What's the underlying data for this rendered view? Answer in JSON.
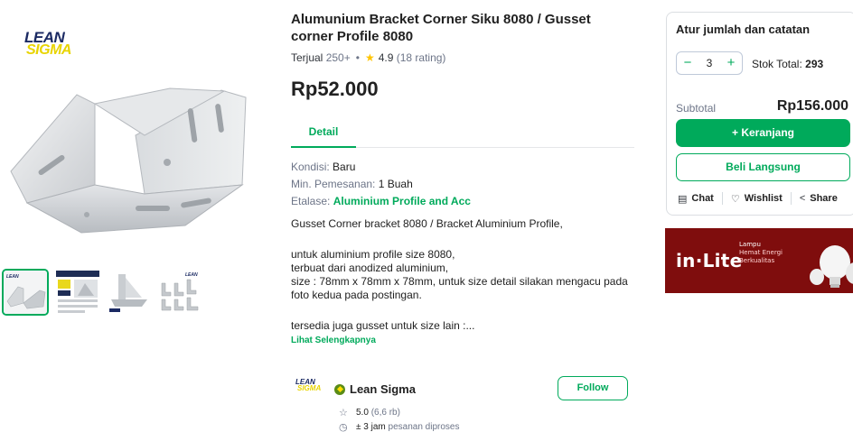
{
  "gallery": {
    "logo_line1": "LEAN",
    "logo_line2": "SIGMA",
    "thumbnails": [
      "bracket-photo",
      "infographic",
      "bracket-angle",
      "bracket-set"
    ]
  },
  "product": {
    "title": "Alumunium Bracket Corner Siku 8080 / Gusset corner Profile 8080",
    "sold_label": "Terjual",
    "sold_count": "250+",
    "separator": "•",
    "rating": "4.9",
    "rating_count": "(18 rating)",
    "price": "Rp52.000",
    "tab_detail": "Detail",
    "specs": [
      {
        "label": "Kondisi: ",
        "value": "Baru"
      },
      {
        "label": "Min. Pemesanan: ",
        "value": "1 Buah"
      },
      {
        "label": "Etalase: ",
        "value": "Aluminium Profile and Acc"
      }
    ],
    "description": [
      "Gusset Corner bracket 8080 / Bracket Aluminium Profile,",
      "untuk aluminium profile size 8080,",
      "terbuat dari anodized aluminium,",
      "size : 78mm x 78mm x 78mm, untuk size detail silakan mengacu pada",
      "foto kedua pada postingan.",
      "tersedia juga gusset untuk size lain :..."
    ],
    "see_more": "Lihat Selengkapnya"
  },
  "shop": {
    "logo_line1": "LEAN",
    "logo_line2": "SIGMA",
    "name": "Lean Sigma",
    "follow_label": "Follow",
    "rating": "5.0",
    "rating_count": "(6,6 rb)",
    "process_time": "± 3 jam",
    "process_label": "pesanan diproses"
  },
  "purchase": {
    "title": "Atur jumlah dan catatan",
    "minus": "−",
    "plus": "+",
    "quantity": "3",
    "stock_label": "Stok Total: ",
    "stock_value": "293",
    "subtotal_label": "Subtotal",
    "subtotal_value": "Rp156.000",
    "add_to_cart": "+ Keranjang",
    "buy_now": "Beli Langsung",
    "chat": "Chat",
    "wishlist": "Wishlist",
    "share": "Share"
  },
  "banner": {
    "brand": "in·Lite",
    "line1": "Lampu",
    "line2": "Hemat Energi",
    "line3": "Berkualitas"
  },
  "colors": {
    "accent": "#00aa5b",
    "banner_bg": "#7f0d0d",
    "star": "#ffc400"
  }
}
